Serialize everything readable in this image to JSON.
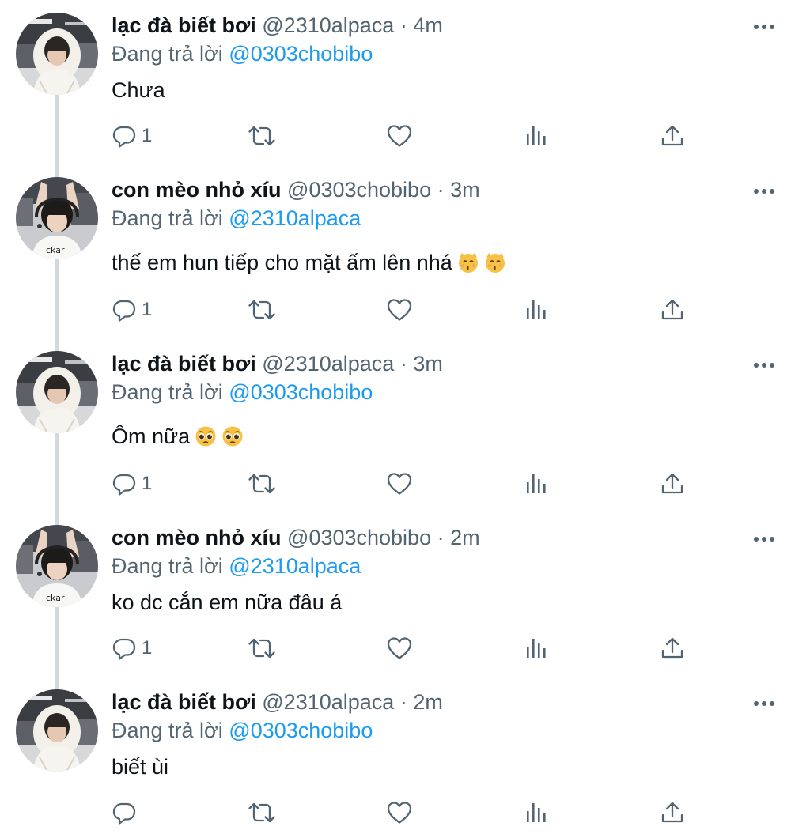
{
  "thread": {
    "replying_prefix": "Đang trả lời",
    "tweets": [
      {
        "name": "lạc đà biết bơi",
        "handle": "@2310alpaca",
        "time": "4m",
        "reply_to": "@0303chobibo",
        "text": "Chưa",
        "emojis": [],
        "reply_count": "1",
        "avatar": "alpaca"
      },
      {
        "name": "con mèo nhỏ xíu",
        "handle": "@0303chobibo",
        "time": "3m",
        "reply_to": "@2310alpaca",
        "text": "thế em hun tiếp cho mặt ấm lên nhá",
        "emojis": [
          "kissing-cat-emoji",
          "kissing-cat-emoji"
        ],
        "reply_count": "1",
        "avatar": "cat"
      },
      {
        "name": "lạc đà biết bơi",
        "handle": "@2310alpaca",
        "time": "3m",
        "reply_to": "@0303chobibo",
        "text": "Ôm nữa",
        "emojis": [
          "pleading-face-emoji",
          "pleading-face-emoji"
        ],
        "reply_count": "1",
        "avatar": "alpaca"
      },
      {
        "name": "con mèo nhỏ xíu",
        "handle": "@0303chobibo",
        "time": "2m",
        "reply_to": "@2310alpaca",
        "text": "ko dc cắn em nữa đâu á",
        "emojis": [],
        "reply_count": "1",
        "avatar": "cat"
      },
      {
        "name": "lạc đà biết bơi",
        "handle": "@2310alpaca",
        "time": "2m",
        "reply_to": "@0303chobibo",
        "text": "biết ùi",
        "emojis": [],
        "reply_count": "",
        "avatar": "alpaca"
      }
    ]
  },
  "colors": {
    "text": "#0f1419",
    "secondary": "#536471",
    "link": "#1d9bf0",
    "thread_line": "#cfd9de"
  },
  "icons": [
    "more-icon",
    "reply-icon",
    "retweet-icon",
    "like-icon",
    "views-icon",
    "share-icon"
  ]
}
